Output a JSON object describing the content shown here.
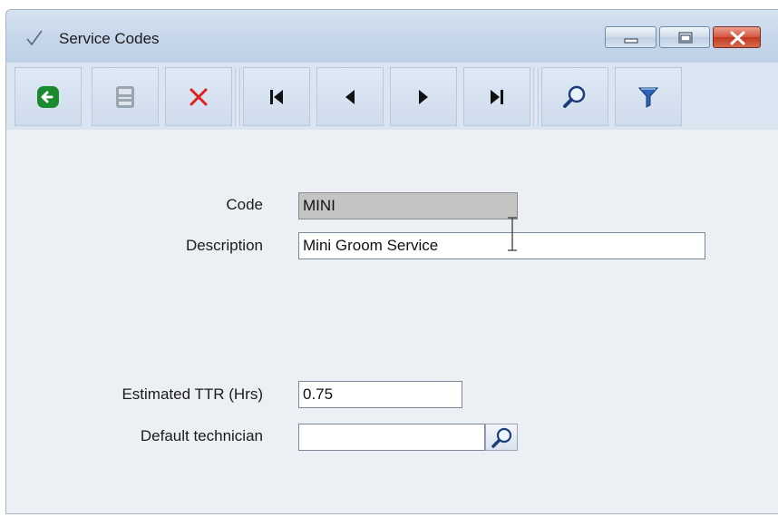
{
  "window": {
    "title": "Service Codes",
    "controls": [
      "minimize",
      "maximize",
      "close"
    ]
  },
  "toolbar": {
    "buttons": [
      {
        "id": "back",
        "icon": "back-arrow-icon",
        "color": "#1a8a2e"
      },
      {
        "id": "save",
        "icon": "save-icon",
        "color": "#8a96a4"
      },
      {
        "id": "delete",
        "icon": "delete-x-icon",
        "color": "#e02020"
      },
      {
        "id": "first",
        "icon": "first-record-icon"
      },
      {
        "id": "previous",
        "icon": "previous-record-icon"
      },
      {
        "id": "next",
        "icon": "next-record-icon"
      },
      {
        "id": "last",
        "icon": "last-record-icon"
      },
      {
        "id": "search",
        "icon": "search-icon"
      },
      {
        "id": "filter",
        "icon": "filter-icon",
        "color": "#1c4f9c"
      }
    ]
  },
  "form": {
    "code": {
      "label": "Code",
      "value": "MINI"
    },
    "description": {
      "label": "Description",
      "value": "Mini Groom Service"
    },
    "estimated_ttr": {
      "label": "Estimated TTR (Hrs)",
      "value": "0.75"
    },
    "default_technician": {
      "label": "Default technician",
      "value": ""
    }
  },
  "colors": {
    "titlebar": "#c6d6ea",
    "toolbar": "#dbe5f1",
    "body": "#eceff4",
    "readonly_field": "#c4c4c4"
  }
}
